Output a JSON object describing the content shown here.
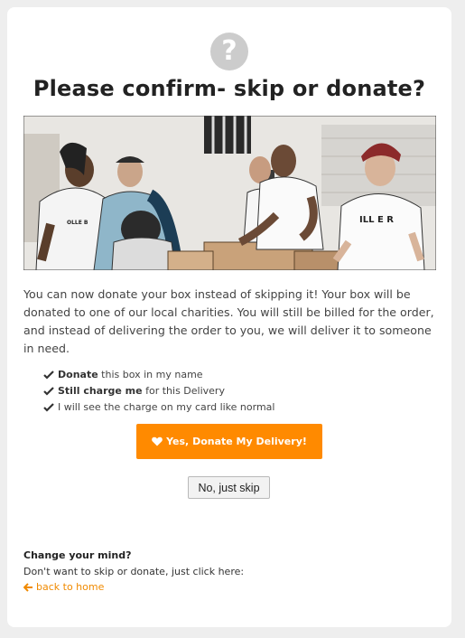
{
  "header": {
    "icon": "question-circle-icon",
    "title": "Please confirm- skip or donate?"
  },
  "photo": {
    "shirt_text_1": "OLLE B",
    "shirt_text_2": "ILL E R"
  },
  "description": "You can now donate your box instead of skipping it! Your box will be donated to one of our local charities. You will still be billed for the order, and instead of delivering the order to you, we will deliver it to someone in need.",
  "checklist": [
    {
      "bold": "Donate",
      "text": " this box in my name"
    },
    {
      "bold": "Still charge me",
      "text": " for this Delivery"
    },
    {
      "bold": "",
      "text": "I will see the charge on my card like normal"
    }
  ],
  "buttons": {
    "donate_label": "Yes, Donate My Delivery!",
    "skip_label": "No, just skip"
  },
  "footer": {
    "title": "Change your mind?",
    "text": "Don't want to skip or donate, just click here:",
    "link_label": "back to home"
  },
  "colors": {
    "accent": "#ff8a00",
    "link": "#f08a00",
    "icon_gray": "#cccccc"
  }
}
